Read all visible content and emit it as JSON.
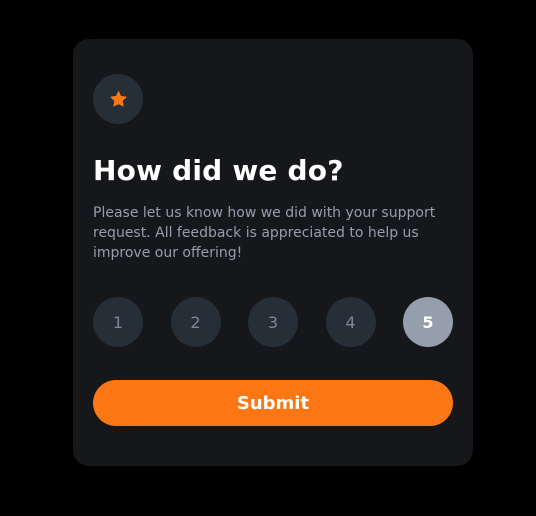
{
  "card": {
    "icon": "star-icon",
    "title": "How did we do?",
    "description": "Please let us know how we did with your support request. All feedback is appreciated to help us improve our offering!",
    "ratings": [
      {
        "label": "1",
        "selected": false
      },
      {
        "label": "2",
        "selected": false
      },
      {
        "label": "3",
        "selected": false
      },
      {
        "label": "4",
        "selected": false
      },
      {
        "label": "5",
        "selected": true
      }
    ],
    "submit_label": "Submit"
  },
  "colors": {
    "page_background": "#000000",
    "card_background": "#16171b",
    "circle_background": "#262e38",
    "selected_background": "#959eac",
    "accent": "#fc7614",
    "text_primary": "#ffffff",
    "text_secondary": "#959eac",
    "rating_text": "#7c8798"
  }
}
